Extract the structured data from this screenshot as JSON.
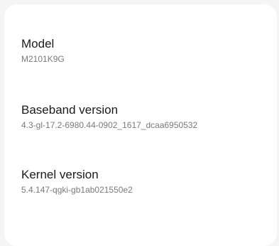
{
  "info_list": {
    "items": [
      {
        "title": "Model",
        "value": "M2101K9G"
      },
      {
        "title": "Baseband version",
        "value": "4.3-gl-17.2-6980.44-0902_1617_dcaa6950532"
      },
      {
        "title": "Kernel version",
        "value": "5.4.147-qgki-gb1ab021550e2"
      }
    ]
  }
}
